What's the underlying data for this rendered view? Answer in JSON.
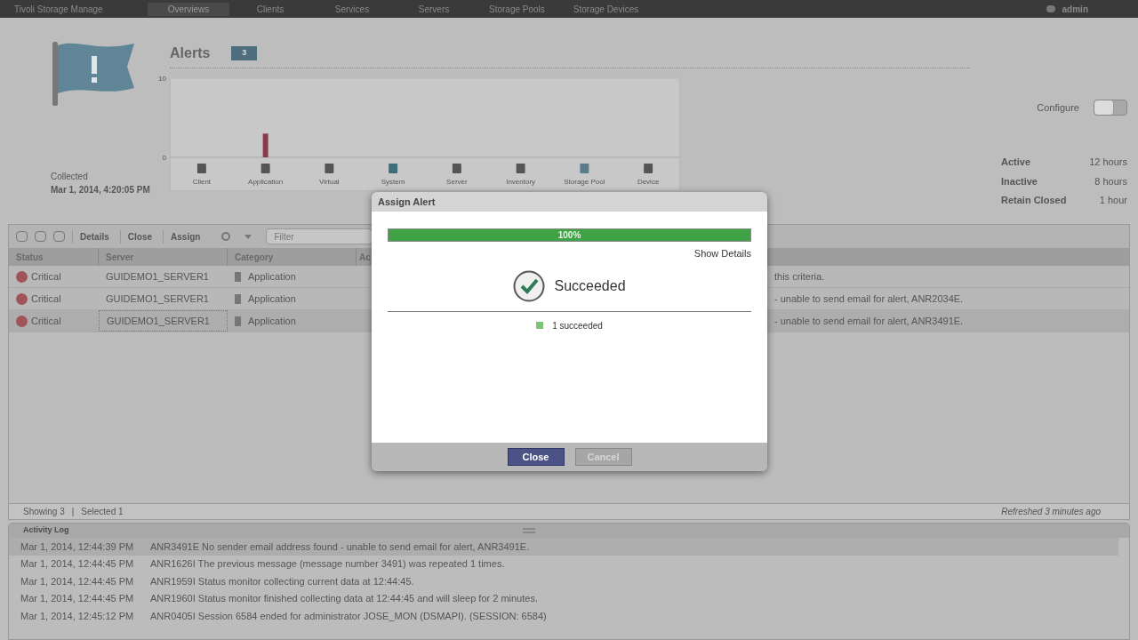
{
  "nav": {
    "product": "Tivoli Storage Manage",
    "items": [
      {
        "label": "Overviews",
        "selected": true
      },
      {
        "label": "Clients",
        "selected": false
      },
      {
        "label": "Services",
        "selected": false
      },
      {
        "label": "Servers",
        "selected": false
      },
      {
        "label": "Storage Pools",
        "selected": false
      },
      {
        "label": "Storage Devices",
        "selected": false
      }
    ],
    "user": "admin"
  },
  "alerts": {
    "title": "Alerts",
    "count": "3",
    "collected_label": "Collected",
    "collected_time": "Mar 1, 2014, 4:20:05 PM",
    "chart_data": {
      "type": "bar",
      "categories": [
        "Client",
        "Application",
        "Virtual",
        "System",
        "Server",
        "Inventory",
        "Storage Pool",
        "Device"
      ],
      "values": [
        0,
        3,
        0,
        0,
        0,
        0,
        0,
        0
      ],
      "ylim": [
        0,
        10
      ],
      "yticks": [
        0,
        10
      ]
    },
    "configure": {
      "label": "Configure",
      "on": false
    },
    "retention": [
      {
        "label": "Active",
        "value": "12 hours"
      },
      {
        "label": "Inactive",
        "value": "8 hours"
      },
      {
        "label": "Retain Closed",
        "value": "1 hour"
      }
    ]
  },
  "toolbar": {
    "buttons": [
      "Details",
      "Close",
      "Assign"
    ],
    "filter_placeholder": "Filter"
  },
  "table": {
    "columns": [
      "Status",
      "Server",
      "Category",
      "Ac"
    ],
    "rows": [
      {
        "status": "Critical",
        "server": "GUIDEMO1_SERVER1",
        "category": "Application",
        "message": "this criteria.",
        "selected": false
      },
      {
        "status": "Critical",
        "server": "GUIDEMO1_SERVER1",
        "category": "Application",
        "message": "- unable to send email for alert, ANR2034E.",
        "selected": false
      },
      {
        "status": "Critical",
        "server": "GUIDEMO1_SERVER1",
        "category": "Application",
        "message": "- unable to send email for alert, ANR3491E.",
        "selected": true
      }
    ]
  },
  "status_bar": {
    "showing": "Showing 3",
    "separator": "|",
    "selected": "Selected 1",
    "refreshed": "Refreshed 3 minutes ago"
  },
  "activity_log": {
    "title": "Activity Log",
    "rows": [
      {
        "time": "Mar 1, 2014, 12:44:39 PM",
        "message": "ANR3491E No sender email address found - unable to send email for alert, ANR3491E.",
        "selected": true
      },
      {
        "time": "Mar 1, 2014, 12:44:45 PM",
        "message": "ANR1626I The previous message (message number 3491) was repeated 1 times.",
        "selected": false
      },
      {
        "time": "Mar 1, 2014, 12:44:45 PM",
        "message": "ANR1959I Status monitor collecting current data at 12:44:45.",
        "selected": false
      },
      {
        "time": "Mar 1, 2014, 12:44:45 PM",
        "message": "ANR1960I Status monitor finished collecting data at 12:44:45 and will sleep for 2 minutes.",
        "selected": false
      },
      {
        "time": "Mar 1, 2014, 12:45:12 PM",
        "message": "ANR0405I Session 6584 ended for administrator JOSE_MON (DSMAPI). (SESSION: 6584)",
        "selected": false
      }
    ]
  },
  "dialog": {
    "title": "Assign Alert",
    "progress": {
      "level": 1,
      "label": "100%"
    },
    "show_details": "Show Details",
    "result": "Succeeded",
    "summary": "1 succeeded",
    "buttons": [
      {
        "label": "Close",
        "disabled": false
      },
      {
        "label": "Cancel",
        "disabled": true
      }
    ]
  }
}
